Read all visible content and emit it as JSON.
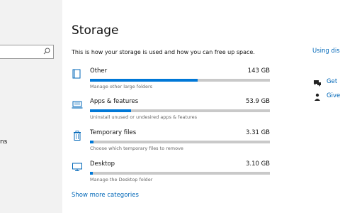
{
  "sidebar": {
    "search_icon": "search-icon",
    "fragment_text": "ns"
  },
  "main": {
    "title": "Storage",
    "intro": "This is how your storage is used and how you can free up space.",
    "categories": [
      {
        "name": "Other",
        "size": "143 GB",
        "desc": "Manage other large folders",
        "icon": "folder-icon",
        "fill": 0.6
      },
      {
        "name": "Apps & features",
        "size": "53.9 GB",
        "desc": "Uninstall unused or undesired apps & features",
        "icon": "laptop-icon",
        "fill": 0.23
      },
      {
        "name": "Temporary files",
        "size": "3.31 GB",
        "desc": "Choose which temporary files to remove",
        "icon": "trash-icon",
        "fill": 0.02
      },
      {
        "name": "Desktop",
        "size": "3.10 GB",
        "desc": "Manage the Desktop folder",
        "icon": "monitor-icon",
        "fill": 0.015
      }
    ],
    "more_link": "Show more categories"
  },
  "right": {
    "using_link": "Using dis",
    "get_link": "Get",
    "give_link": "Give",
    "accent": "#0067b8"
  },
  "colors": {
    "bar_fill": "#0078d7",
    "bar_track": "#c9c9c9",
    "sidebar_bg": "#f2f2f2"
  }
}
